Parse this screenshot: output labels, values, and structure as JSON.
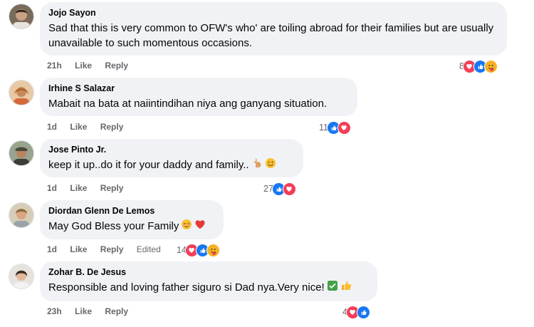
{
  "comments": [
    {
      "author": "Jojo Sayon",
      "text": "Sad that this is very common to OFW's who' are toiling abroad for their families but are usually unavailable to such momentous occasions.",
      "time": "21h",
      "like": "Like",
      "reply": "Reply",
      "reaction_count": "8",
      "reactions": [
        "love-icon",
        "like-icon",
        "care-icon"
      ]
    },
    {
      "author": "Irhine S Salazar",
      "text": "Mabait na bata at naiintindihan niya ang ganyang situation.",
      "time": "1d",
      "like": "Like",
      "reply": "Reply",
      "reaction_count": "11",
      "reactions": [
        "like-icon",
        "love-icon"
      ]
    },
    {
      "author": "Jose Pinto Jr.",
      "text": "keep it up..do it for your daddy and family..",
      "emojis": [
        "pointing-hand-emoji",
        "smiling-face-emoji"
      ],
      "time": "1d",
      "like": "Like",
      "reply": "Reply",
      "reaction_count": "27",
      "reactions": [
        "like-icon",
        "love-icon"
      ]
    },
    {
      "author": "Diordan Glenn De Lemos",
      "text": "May God Bless your Family",
      "emojis": [
        "relieved-face-emoji",
        "red-heart-emoji"
      ],
      "time": "1d",
      "like": "Like",
      "reply": "Reply",
      "edited": "Edited",
      "reaction_count": "14",
      "reactions": [
        "love-icon",
        "like-icon",
        "care-icon"
      ]
    },
    {
      "author": "Zohar B. De Jesus",
      "text": "Responsible and loving father siguro si Dad nya.Very nice!",
      "emojis": [
        "check-mark-emoji",
        "thumbs-up-emoji"
      ],
      "time": "23h",
      "like": "Like",
      "reply": "Reply",
      "reaction_count": "4",
      "reactions": [
        "love-icon",
        "like-icon"
      ]
    }
  ]
}
